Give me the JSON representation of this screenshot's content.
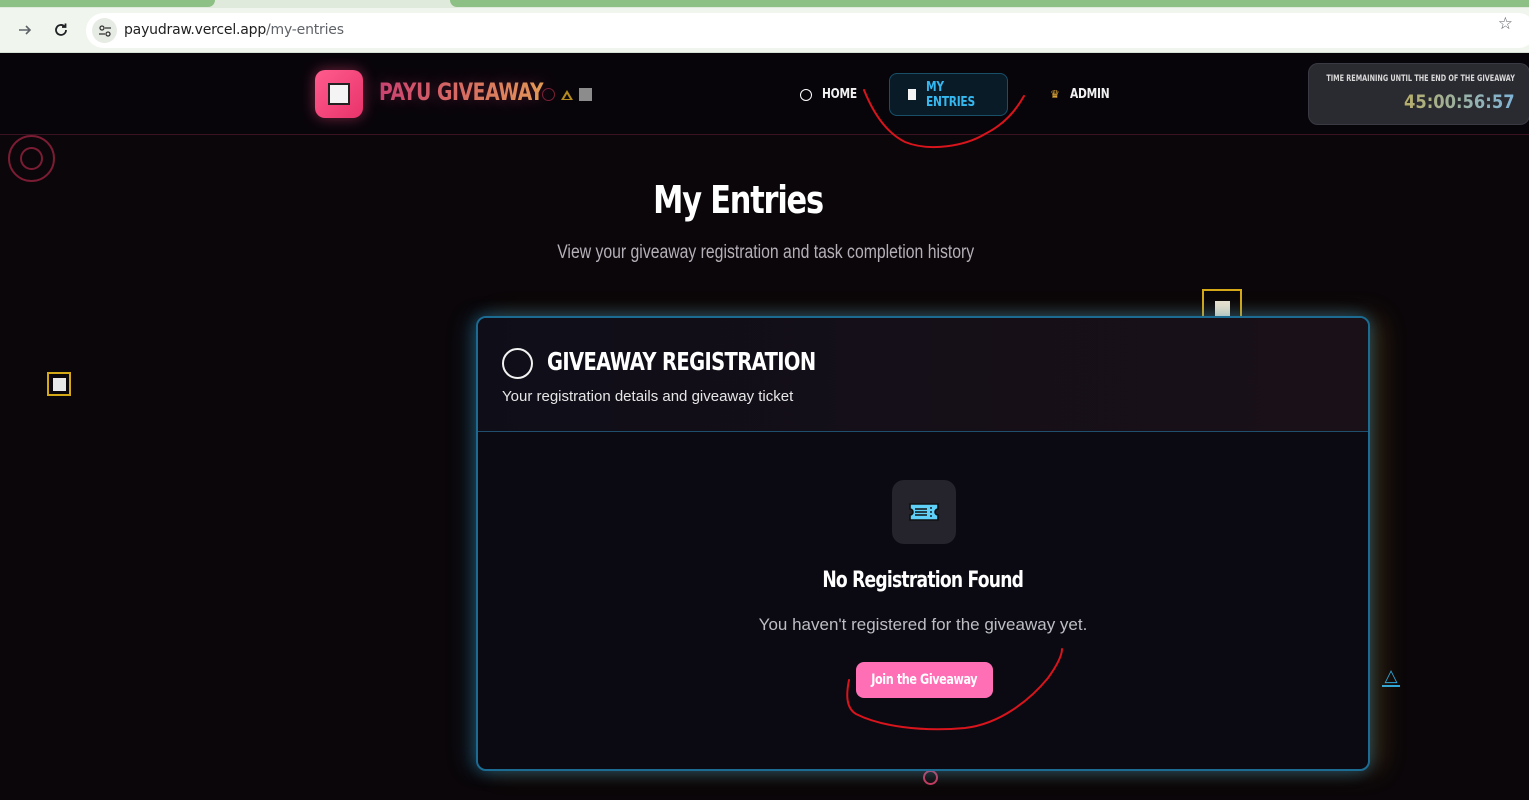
{
  "browser": {
    "url_domain": "payudraw.vercel.app",
    "url_path": "/my-entries",
    "back_icon": "arrow-right-icon",
    "reload_icon": "reload-icon",
    "bookmark_icon": "star-icon"
  },
  "header": {
    "brand": "PAYU GIVEAWAY",
    "nav": [
      {
        "label": "HOME",
        "icon": "ring-icon",
        "active": false
      },
      {
        "label": "MY ENTRIES",
        "icon": "square-icon",
        "active": true
      },
      {
        "label": "ADMIN",
        "icon": "crown-icon",
        "active": false
      }
    ],
    "timer_label": "TIME REMAINING UNTIL THE END OF THE GIVEAWAY",
    "timer_value": "45:00:56:57"
  },
  "page": {
    "title": "My Entries",
    "subtitle": "View your giveaway registration and task completion history"
  },
  "card": {
    "title": "GIVEAWAY REGISTRATION",
    "description": "Your registration details and giveaway ticket",
    "empty_title": "No Registration Found",
    "empty_text": "You haven't registered for the giveaway yet.",
    "button_label": "Join the Giveaway",
    "icon": "ticket-icon"
  },
  "colors": {
    "accent_blue": "#35b8f0",
    "accent_pink": "#ff6fb5",
    "accent_gold": "#d4a817",
    "annotation_red": "#d8141c"
  }
}
